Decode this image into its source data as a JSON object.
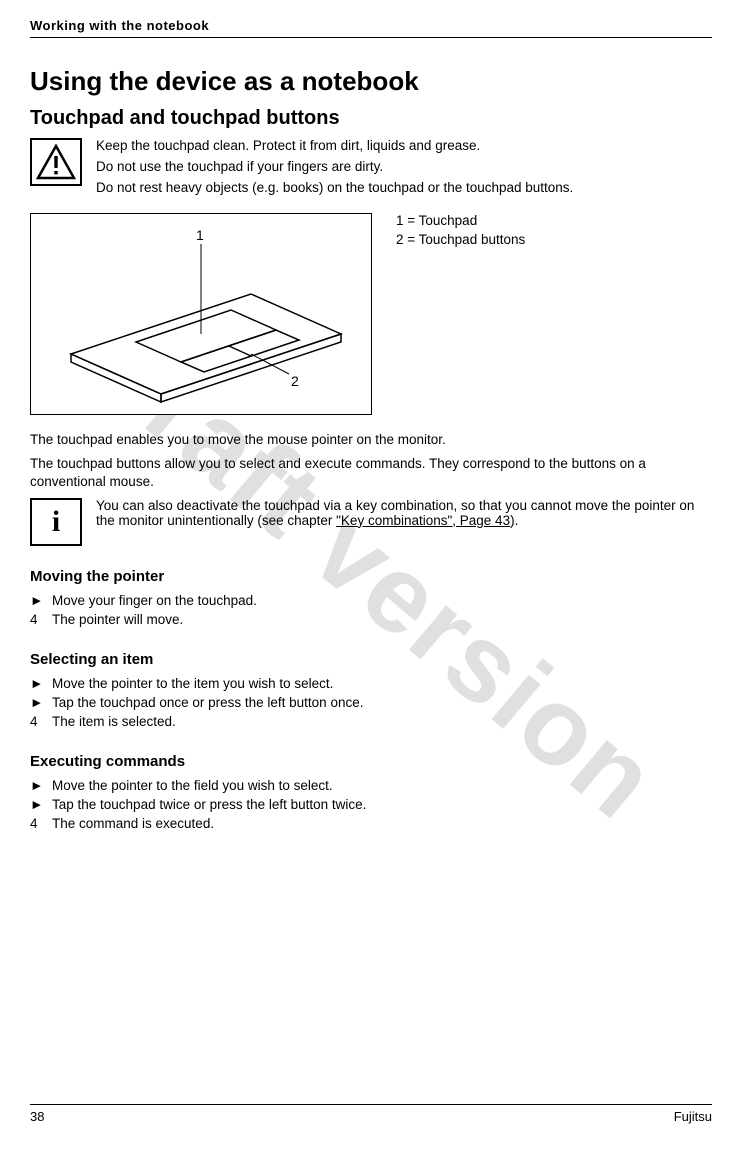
{
  "running_head": "Working  with  the  notebook",
  "watermark": "Draft version",
  "h1": "Using the device as a notebook",
  "h2": "Touchpad and touchpad buttons",
  "warning": {
    "line1": "Keep the touchpad clean. Protect it from dirt, liquids and grease.",
    "line2": "Do  not  use  the  touchpad  if  your  fingers  are  dirty.",
    "line3": "Do not rest heavy objects (e.g. books) on the touchpad or the touchpad buttons."
  },
  "diagram": {
    "label1": "1",
    "label2": "2"
  },
  "legend": {
    "item1": "1 = Touchpad",
    "item2": "2 = Touchpad buttons"
  },
  "para1": "The touchpad enables you to move the mouse pointer on the monitor.",
  "para2": "The touchpad buttons allow you to select and execute commands. They correspond to  the  buttons  on  a  conventional  mouse.",
  "info": {
    "prefix": "You can also deactivate the touchpad via a key combination, so that you cannot move the pointer on the monitor unintentionally (see chapter ",
    "link": "\"Key combinations\", Page 43",
    "suffix": ")."
  },
  "sec_move": {
    "title": "Moving  the  pointer",
    "step1": "Move  your  finger  on  the  touchpad.",
    "result": "The  pointer  will  move."
  },
  "sec_select": {
    "title": "Selecting  an  item",
    "step1": "Move  the  pointer  to  the  item  you  wish  to  select.",
    "step2": "Tap the touchpad once or press the left button once.",
    "result": "The  item  is  selected."
  },
  "sec_exec": {
    "title": "Executing  commands",
    "step1": "Move  the  pointer  to  the  field  you  wish  to  select.",
    "step2": "Tap the touchpad twice or press the left button twice.",
    "result": "The  command  is  executed."
  },
  "bullets": {
    "action": "►",
    "result": "4"
  },
  "footer": {
    "left": "38",
    "right": "Fujitsu"
  }
}
